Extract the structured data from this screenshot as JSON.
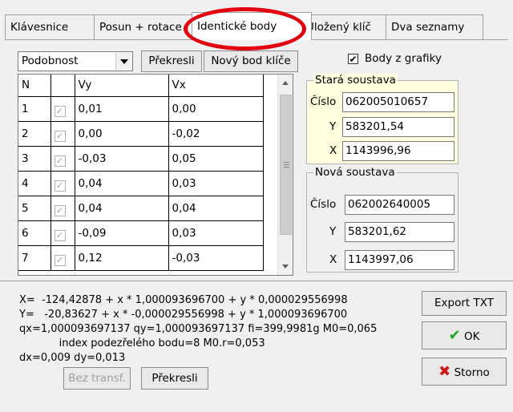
{
  "tabs": [
    {
      "label": "Klávesnice"
    },
    {
      "label": "Posun + rotace"
    },
    {
      "label": "Identické body"
    },
    {
      "label": "Uložený klíč"
    },
    {
      "label": "Dva seznamy"
    }
  ],
  "method_select": {
    "value": "Podobnost"
  },
  "buttons": {
    "prekresli_top": "Překresli",
    "novy_bod": "Nový bod klíče",
    "export": "Export TXT",
    "ok": "OK",
    "storno": "Storno",
    "bez_transf": "Bez transf.",
    "prekresli_bottom": "Překresli"
  },
  "body_z_grafiky": {
    "label": "Body z grafiky",
    "checked": true
  },
  "grid": {
    "headers": [
      "N",
      "",
      "Vy",
      "Vx"
    ],
    "rows": [
      {
        "n": "1",
        "checked": true,
        "vy": "0,01",
        "vx": "0,00"
      },
      {
        "n": "2",
        "checked": true,
        "vy": "0,00",
        "vx": "-0,02"
      },
      {
        "n": "3",
        "checked": true,
        "vy": "-0,03",
        "vx": "0,05"
      },
      {
        "n": "4",
        "checked": true,
        "vy": "0,04",
        "vx": "0,03"
      },
      {
        "n": "5",
        "checked": true,
        "vy": "0,04",
        "vx": "0,04"
      },
      {
        "n": "6",
        "checked": true,
        "vy": "-0,09",
        "vx": "0,03"
      },
      {
        "n": "7",
        "checked": true,
        "vy": "0,12",
        "vx": "-0,03"
      }
    ]
  },
  "stara": {
    "caption": "Stará soustava",
    "cislo_label": "Číslo",
    "cislo": "062005010657",
    "y_label": "Y",
    "y": "583201,54",
    "x_label": "X",
    "x": "1143996,96"
  },
  "nova": {
    "caption": "Nová soustava",
    "cislo_label": "Číslo",
    "cislo": "062002640005",
    "y_label": "Y",
    "y": "583201,62",
    "x_label": "X",
    "x": "1143997,06"
  },
  "results": [
    "X=  -124,42878 + x * 1,000093696700 + y * 0,000029556998",
    "Y=   -20,83627 + x * -0,000029556998 + y * 1,000093696700",
    "qx=1,000093697137 qy=1,000093697137 fi=399,9981g M0=0,065",
    "            index podezřelého bodu=8 M0.r=0,053",
    "dx=0,009 dy=0,013"
  ],
  "colors": {
    "annotation": "#e3000f",
    "ok_icon": "#1ea51e",
    "storno_icon": "#d01818",
    "groupbox_fill": "#ffffe0"
  }
}
